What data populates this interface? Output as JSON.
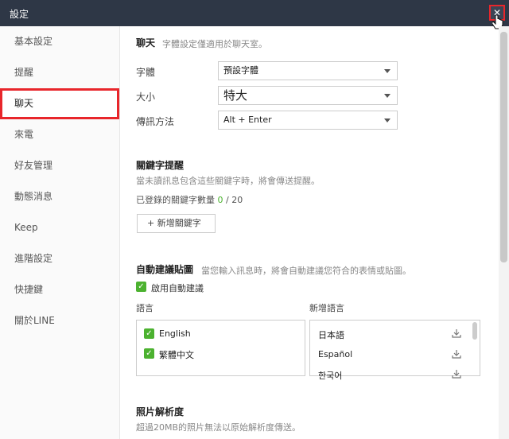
{
  "window": {
    "title": "設定"
  },
  "sidebar": {
    "items": [
      {
        "label": "基本設定",
        "active": false
      },
      {
        "label": "提醒",
        "active": false
      },
      {
        "label": "聊天",
        "active": true
      },
      {
        "label": "來電",
        "active": false
      },
      {
        "label": "好友管理",
        "active": false
      },
      {
        "label": "動態消息",
        "active": false
      },
      {
        "label": "Keep",
        "active": false
      },
      {
        "label": "進階設定",
        "active": false
      },
      {
        "label": "快捷鍵",
        "active": false
      },
      {
        "label": "關於LINE",
        "active": false
      }
    ]
  },
  "chat": {
    "title": "聊天",
    "desc": "字體設定僅適用於聊天室。",
    "font_label": "字體",
    "font_value": "預設字體",
    "size_label": "大小",
    "size_value": "特大",
    "send_label": "傳訊方法",
    "send_value": "Alt + Enter"
  },
  "keywords": {
    "title": "關鍵字提醒",
    "desc": "當未讀訊息包含這些關鍵字時，將會傳送提醒。",
    "count_label": "已登錄的關鍵字數量",
    "count_current": "0",
    "count_sep": " / ",
    "count_max": "20",
    "add_label": "+ 新增關鍵字"
  },
  "auto_suggest": {
    "title": "自動建議貼圖",
    "desc": "當您輸入訊息時，將會自動建議您符合的表情或貼圖。",
    "enable_label": "啟用自動建議",
    "enabled": true,
    "languages_header": "語言",
    "add_languages_header": "新增語言",
    "languages": [
      {
        "label": "English",
        "checked": true
      },
      {
        "label": "繁體中文",
        "checked": true
      }
    ],
    "add_languages": [
      {
        "label": "日本語"
      },
      {
        "label": "Español"
      },
      {
        "label": "한국어"
      }
    ]
  },
  "photo": {
    "title": "照片解析度",
    "desc": "超過20MB的照片無法以原始解析度傳送。"
  },
  "icons": {
    "close": "close-icon",
    "dropdown": "chevron-down-icon",
    "check": "check-icon",
    "download": "download-icon",
    "cursor": "pointer-cursor-icon"
  },
  "colors": {
    "titlebar": "#2e3746",
    "highlight": "#e8262b",
    "check": "#4cb230"
  }
}
